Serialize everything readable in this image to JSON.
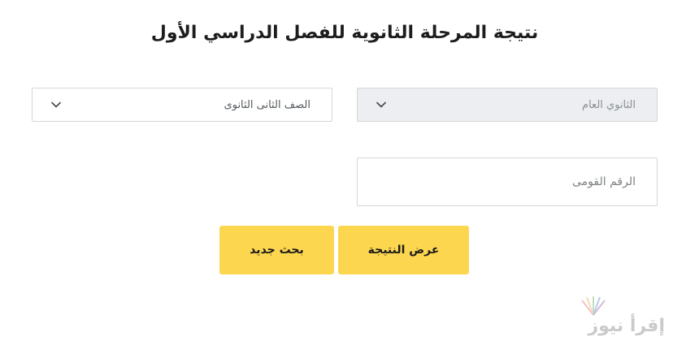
{
  "form": {
    "title": "نتيجة المرحلة الثانوية للفصل الدراسي الأول",
    "track_select": {
      "value": "الثانوي العام"
    },
    "grade_select": {
      "value": "الصف الثانى الثانوى"
    },
    "national_id": {
      "placeholder": "الرقم القومى",
      "value": ""
    },
    "show_result_label": "عرض النتيجة",
    "new_search_label": "بحث جديد"
  },
  "watermark": {
    "text": "إقرأ نيوز"
  },
  "colors": {
    "button": "#fdd650",
    "disabled_select_bg": "#eceef1",
    "border": "#d6d6d6"
  }
}
